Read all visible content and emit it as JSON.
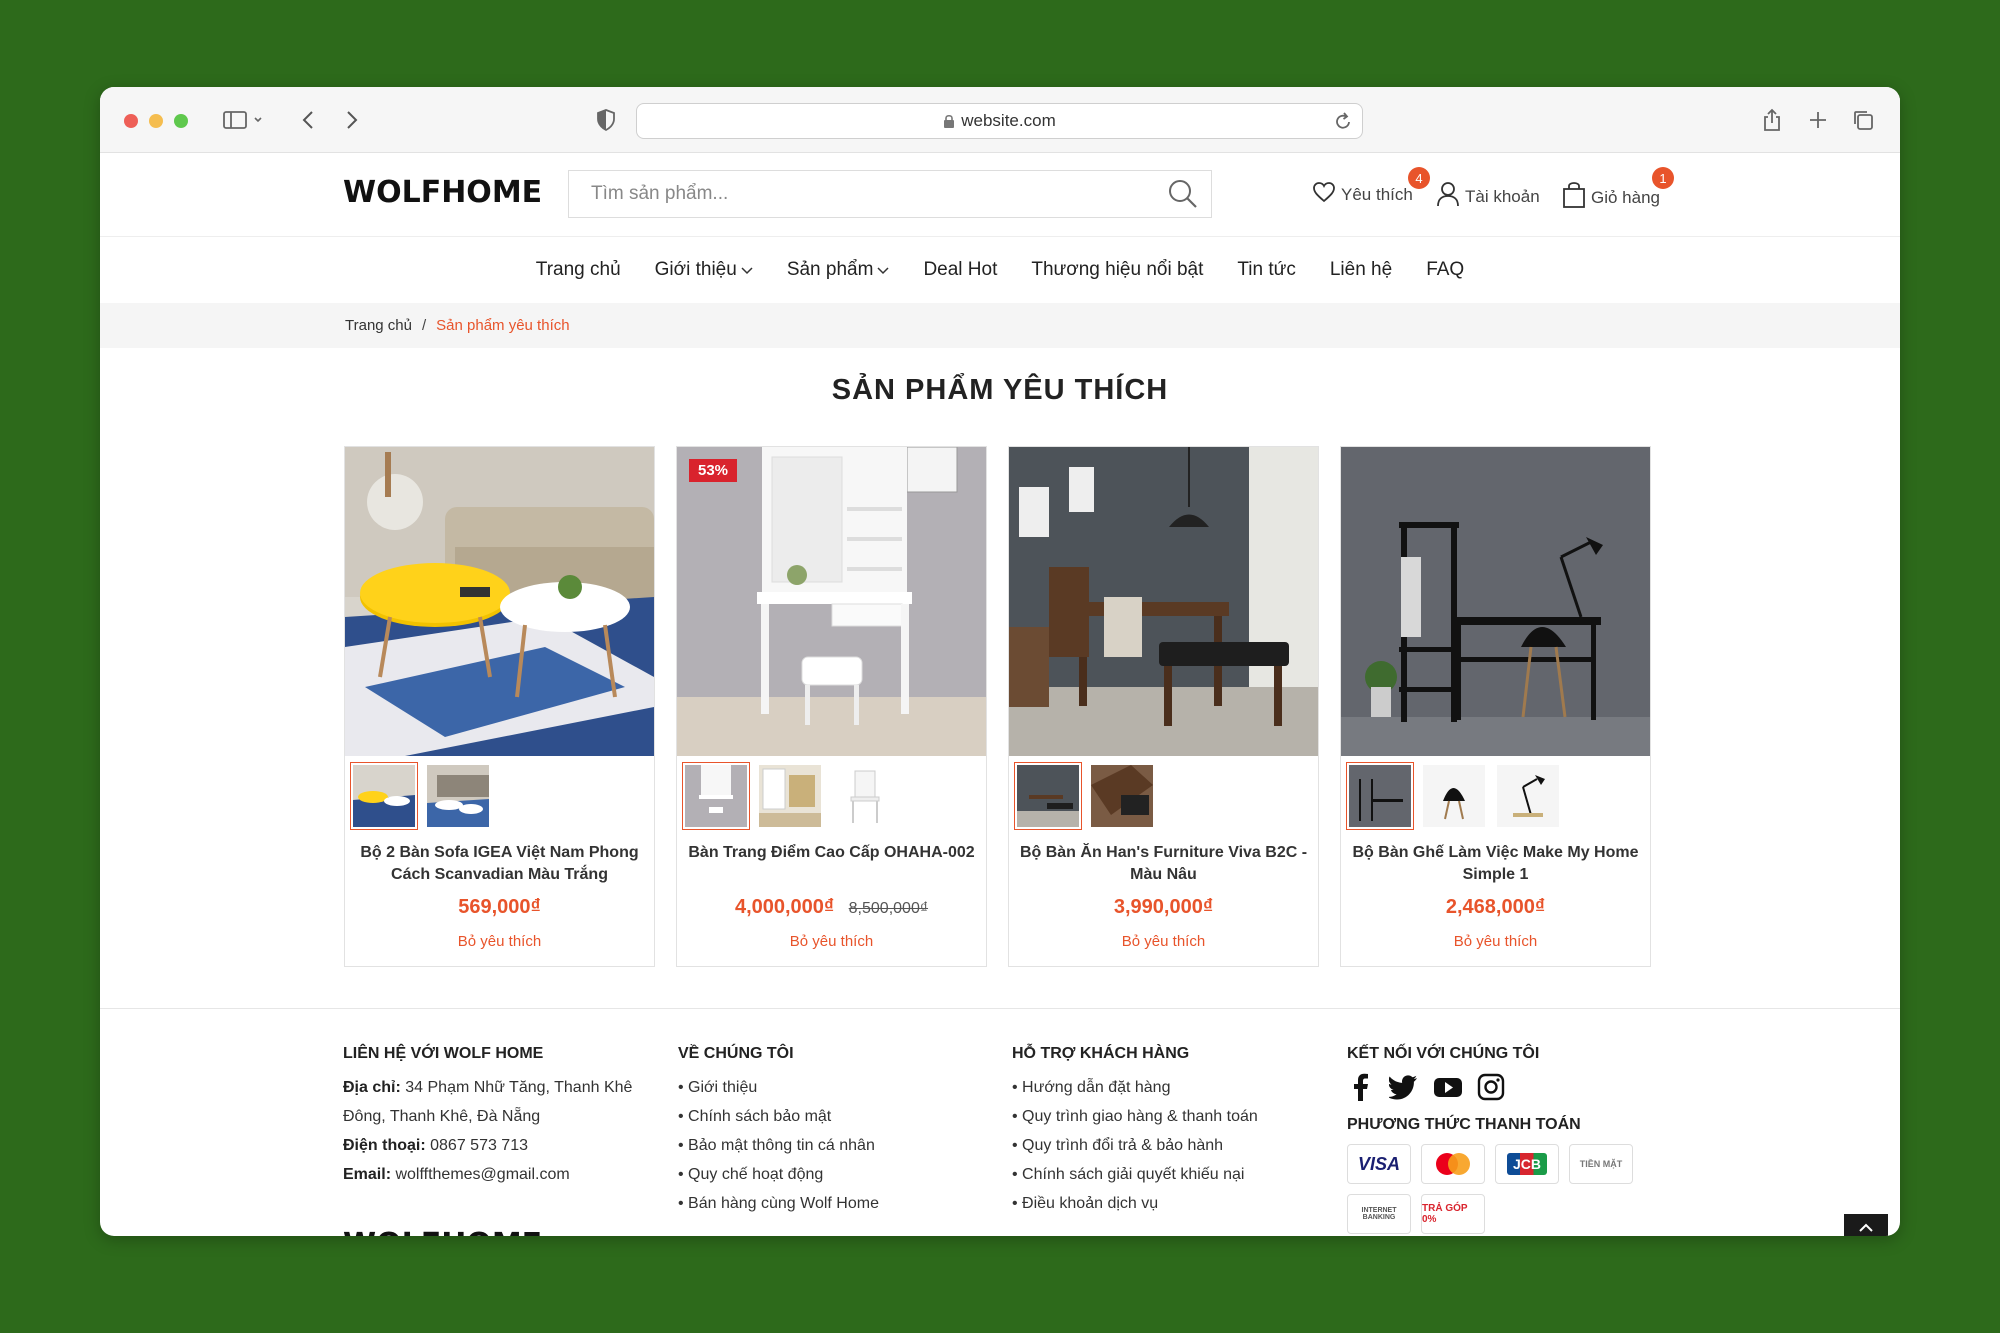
{
  "browser": {
    "url": "website.com"
  },
  "header": {
    "logo": "WOLFHOME",
    "search_placeholder": "Tìm sản phẩm...",
    "wishlist_label": "Yêu thích",
    "wishlist_count": "4",
    "account_label": "Tài khoản",
    "cart_label": "Giỏ hàng",
    "cart_count": "1"
  },
  "nav": {
    "items": [
      {
        "label": "Trang chủ"
      },
      {
        "label": "Giới thiệu"
      },
      {
        "label": "Sản phẩm"
      },
      {
        "label": "Deal Hot"
      },
      {
        "label": "Thương hiệu nổi bật"
      },
      {
        "label": "Tin tức"
      },
      {
        "label": "Liên hệ"
      },
      {
        "label": "FAQ"
      }
    ]
  },
  "breadcrumb": {
    "home": "Trang chủ",
    "separator": "/",
    "current": "Sản phẩm yêu thích"
  },
  "page": {
    "title": "SẢN PHẨM YÊU THÍCH"
  },
  "products": [
    {
      "name": "Bộ 2 Bàn Sofa IGEA Việt Nam Phong Cách Scanvadian Màu Trắng",
      "price": "569,000₫",
      "old_price": "",
      "badge": "",
      "remove_label": "Bỏ yêu thích"
    },
    {
      "name": "Bàn Trang Điểm Cao Cấp OHAHA-002",
      "price": "4,000,000₫",
      "old_price": "8,500,000₫",
      "badge": "53%",
      "remove_label": "Bỏ yêu thích"
    },
    {
      "name": "Bộ Bàn Ăn Han's Furniture Viva B2C - Màu Nâu",
      "price": "3,990,000₫",
      "old_price": "",
      "badge": "",
      "remove_label": "Bỏ yêu thích"
    },
    {
      "name": "Bộ Bàn Ghế Làm Việc Make My Home Simple 1",
      "price": "2,468,000₫",
      "old_price": "",
      "badge": "",
      "remove_label": "Bỏ yêu thích"
    }
  ],
  "footer": {
    "contact": {
      "heading": "LIÊN HỆ VỚI WOLF HOME",
      "address_label": "Địa chỉ:",
      "address": "34 Phạm Nhữ Tăng, Thanh Khê Đông, Thanh Khê, Đà Nẵng",
      "phone_label": "Điện thoại:",
      "phone": "0867 573 713",
      "email_label": "Email:",
      "email": "wolffthemes@gmail.com"
    },
    "about": {
      "heading": "VỀ CHÚNG TÔI",
      "items": [
        "• Giới thiệu",
        "• Chính sách bảo mật",
        "• Bảo mật thông tin cá nhân",
        "• Quy chế hoạt động",
        "• Bán hàng cùng Wolf Home"
      ]
    },
    "support": {
      "heading": "HỖ TRỢ KHÁCH HÀNG",
      "items": [
        "• Hướng dẫn đặt hàng",
        "• Quy trình giao hàng & thanh toán",
        "• Quy trình đổi trả & bảo hành",
        "• Chính sách giải quyết khiếu nại",
        "• Điều khoản dịch vụ"
      ]
    },
    "connect": {
      "heading": "KẾT NỐI VỚI CHÚNG TÔI",
      "payment_heading": "PHƯƠNG THỨC THANH TOÁN",
      "payments": [
        "VISA",
        "",
        "JCB",
        "TIỀN MẶT",
        "INTERNET BANKING",
        "TRẢ GÓP 0%"
      ]
    },
    "logo": "WOLFHOME"
  },
  "colors": {
    "accent": "#e8542b",
    "sale": "#d9232d",
    "background": "#2d6a1b"
  }
}
